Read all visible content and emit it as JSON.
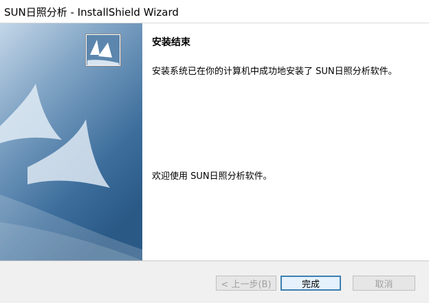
{
  "window": {
    "title": "SUN日照分析 - InstallShield Wizard"
  },
  "content": {
    "heading": "安装结束",
    "message": "安装系统已在你的计算机中成功地安装了 SUN日照分析软件。",
    "welcome": "欢迎使用 SUN日照分析软件。"
  },
  "buttons": {
    "back": "< 上一步(B)",
    "finish": "完成",
    "cancel": "取消"
  },
  "colors": {
    "banner_top": "#a9c3da",
    "banner_bottom": "#2a5f8f",
    "default_button_border": "#3c7fb1"
  },
  "icons": {
    "logo": "installshield-sails-logo"
  }
}
